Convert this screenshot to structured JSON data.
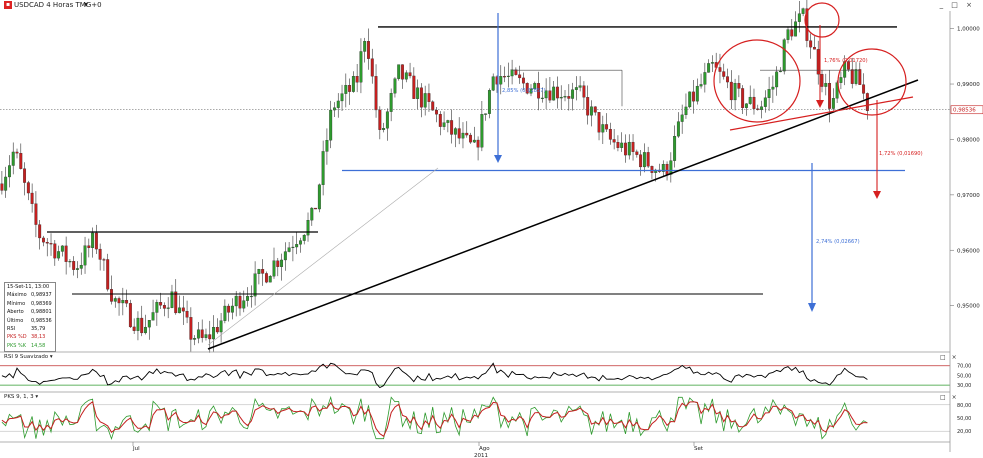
{
  "header": {
    "symbol_title": "USDCAD 4 Horas TMG+0",
    "icon": "chart-app-icon",
    "window_controls": "_ □ ×"
  },
  "info_box": {
    "date": "15-Set-11, 13:00",
    "rows": [
      {
        "label": "Máximo",
        "value": "0,98937"
      },
      {
        "label": "Mínimo",
        "value": "0,98369"
      },
      {
        "label": "Aberto",
        "value": "0,98801"
      },
      {
        "label": "Último",
        "value": "0,98536"
      },
      {
        "label": "RSI",
        "value": "35,79"
      },
      {
        "label": "PKS %D",
        "value": "38,13"
      },
      {
        "label": "PKS %K",
        "value": "14,58"
      }
    ]
  },
  "rsi_panel": {
    "title": "RSI 9 Suavizado",
    "controls": "□ ×",
    "levels": [
      "70,00",
      "50,00",
      "30,00"
    ]
  },
  "pks_panel": {
    "title": "PKS 9, 1, 3",
    "controls": "□ ×",
    "levels": [
      "80,00",
      "50,00",
      "20,00"
    ]
  },
  "annotations": {
    "upper_left": "2,85% (0,02857)",
    "upper_right": "1,76% (0,01720)",
    "target_red": "1,72% (0,01690)",
    "target_blue": "2,74% (0,02667)"
  },
  "last_price_tag": "0,98536",
  "colors": {
    "up": "#2e9a2e",
    "down": "#c42020",
    "trend": "#000000",
    "measure": "#3d6fd6",
    "circle": "#d62020",
    "rsi_hi": "#c03030",
    "rsi_lo": "#2e9a2e"
  },
  "chart_data": {
    "type": "candlestick",
    "symbol": "USDCAD",
    "timeframe": "4 Horas",
    "y_ticks": [
      "1,00000",
      "0,99000",
      "0,98000",
      "0,97000",
      "0,96000",
      "0,95000"
    ],
    "ylim": [
      0.942,
      1.003
    ],
    "x_ticks": [
      "Jul",
      "Ago",
      "Set"
    ],
    "x_year": "2011",
    "key_levels": {
      "resistance": 1.0003,
      "neckline_blue": 0.9744,
      "support_left_low": 0.9521,
      "support_left_high": 0.9633,
      "mid_range_high": 0.9925
    },
    "close_path": [
      {
        "t": 0.0,
        "v": 0.972
      },
      {
        "t": 0.015,
        "v": 0.978
      },
      {
        "t": 0.04,
        "v": 0.963
      },
      {
        "t": 0.08,
        "v": 0.957
      },
      {
        "t": 0.1,
        "v": 0.962
      },
      {
        "t": 0.12,
        "v": 0.951
      },
      {
        "t": 0.15,
        "v": 0.946
      },
      {
        "t": 0.18,
        "v": 0.952
      },
      {
        "t": 0.2,
        "v": 0.945
      },
      {
        "t": 0.215,
        "v": 0.9435
      },
      {
        "t": 0.25,
        "v": 0.951
      },
      {
        "t": 0.28,
        "v": 0.956
      },
      {
        "t": 0.31,
        "v": 0.962
      },
      {
        "t": 0.33,
        "v": 0.966
      },
      {
        "t": 0.35,
        "v": 0.986
      },
      {
        "t": 0.375,
        "v": 0.99
      },
      {
        "t": 0.385,
        "v": 1.0
      },
      {
        "t": 0.4,
        "v": 0.98
      },
      {
        "t": 0.42,
        "v": 0.992
      },
      {
        "t": 0.44,
        "v": 0.988
      },
      {
        "t": 0.47,
        "v": 0.982
      },
      {
        "t": 0.5,
        "v": 0.978
      },
      {
        "t": 0.52,
        "v": 0.992
      },
      {
        "t": 0.55,
        "v": 0.99
      },
      {
        "t": 0.58,
        "v": 0.989
      },
      {
        "t": 0.61,
        "v": 0.988
      },
      {
        "t": 0.64,
        "v": 0.98
      },
      {
        "t": 0.67,
        "v": 0.977
      },
      {
        "t": 0.7,
        "v": 0.974
      },
      {
        "t": 0.72,
        "v": 0.985
      },
      {
        "t": 0.75,
        "v": 0.993
      },
      {
        "t": 0.78,
        "v": 0.987
      },
      {
        "t": 0.8,
        "v": 0.986
      },
      {
        "t": 0.815,
        "v": 0.99
      },
      {
        "t": 0.83,
        "v": 0.9995
      },
      {
        "t": 0.845,
        "v": 1.002
      },
      {
        "t": 0.86,
        "v": 0.994
      },
      {
        "t": 0.875,
        "v": 0.986
      },
      {
        "t": 0.89,
        "v": 0.9925
      },
      {
        "t": 0.905,
        "v": 0.99
      },
      {
        "t": 0.915,
        "v": 0.9854
      }
    ]
  }
}
